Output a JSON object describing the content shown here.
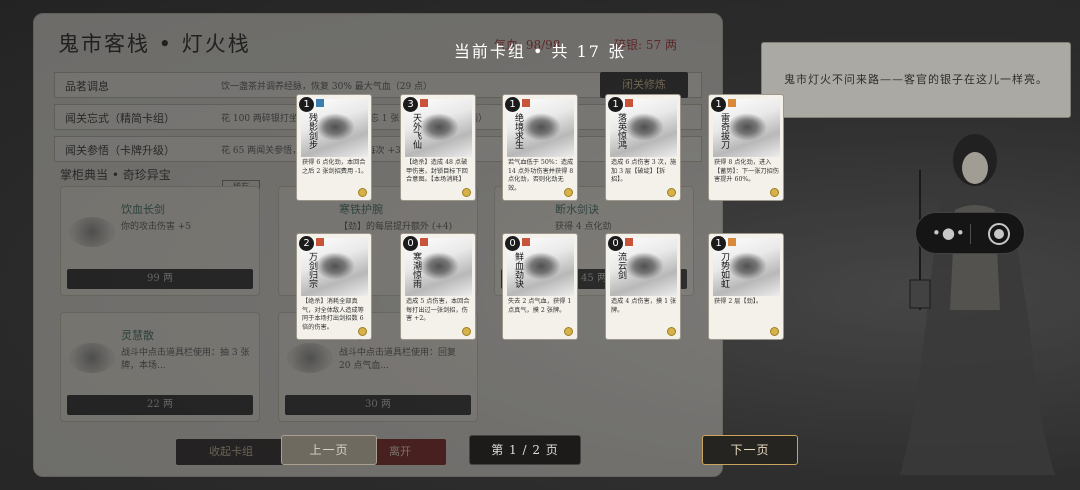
{
  "shop": {
    "title": "鬼市客栈 • 灯火栈",
    "stat_hp": "气血: 98/98",
    "stat_silver": "碎银: 57 两",
    "rows": [
      {
        "name": "品茗调息",
        "desc": "饮一盏茶并调养经脉，恢复 30% 最大气血（29 点）"
      },
      {
        "name": "闻关忘式（精简卡组）",
        "desc": "花 100 两碎银打坐，从卡组中永久遗忘 1 张卡牌（每次 +50 两）"
      },
      {
        "name": "闻关参悟（卡牌升级）",
        "desc": "花 65 两闻关参悟，升级 1 张卡牌（每次 +35 两）"
      }
    ],
    "rest_button": "闭关修炼",
    "section": "掌柜典当 • 奇珍异宝",
    "section_badge": "稀有",
    "items": [
      {
        "name": "饮血长剑",
        "desc": "你的攻击伤害 +5",
        "price": "99 两"
      },
      {
        "name": "寒铁护腕",
        "desc": "【劲】的每层提升额外 (+4)",
        "price": "88 两"
      },
      {
        "name": "断水剑诀",
        "desc": "获得 4 点化劲",
        "price": "45 两"
      },
      {
        "name": "灵慧散",
        "desc": "战斗中点击道具栏使用：抽 3 张牌，本场...",
        "price": "22 两"
      },
      {
        "name": "回气丹",
        "desc": "战斗中点击道具栏使用：回复 20 点气血...",
        "price": "30 两"
      }
    ],
    "collapse_button": "收起卡组",
    "leave_button": "离开"
  },
  "notice": "鬼市灯火不问来路——客官的银子在这儿一样亮。",
  "deck": {
    "title": "当前卡组 • 共 17 张",
    "cards": [
      {
        "cost": "1",
        "name": "残影剑步",
        "desc": "获得 6 点化劲，本回合之后 2 张剑招费用 -1。",
        "color": "#3b7fb0"
      },
      {
        "cost": "3",
        "name": "天外飞仙",
        "desc": "【绝杀】造成 48 点破甲伤害，封锁目标下回合意图。【本场消耗】",
        "color": "#c8553a"
      },
      {
        "cost": "1",
        "name": "绝境求生",
        "desc": "若气血低于 50%：造成 14 点外功伤害并获得 8 点化劲，否则化劲无效。",
        "color": "#c8553a"
      },
      {
        "cost": "1",
        "name": "落英惊鸿",
        "desc": "造成 6 点伤害 3 次，施加 3 层【破绽】【拆招】。",
        "color": "#c8553a"
      },
      {
        "cost": "1",
        "name": "雷奇拔刀",
        "desc": "获得 8 点化劲，进入【蓄势】：下一张刀招伤害提升 60%。",
        "color": "#d9893a"
      },
      {
        "cost": "2",
        "name": "万剑归宗",
        "desc": "【绝杀】消耗全部真气，对全体敌人造成等同于本场打出剑招数 6 倍的伤害。",
        "color": "#c8553a"
      },
      {
        "cost": "0",
        "name": "寒潮惊雨",
        "desc": "造成 5 点伤害，本回合每打出过一张剑招，伤害 +2。",
        "color": "#c8553a"
      },
      {
        "cost": "0",
        "name": "鲜血劲诀",
        "desc": "失去 2 点气血，获得 1 点真气，摸 2 张牌。",
        "color": "#c8553a"
      },
      {
        "cost": "0",
        "name": "流云剑",
        "desc": "造成 4 点伤害，摸 1 张牌。",
        "color": "#c8553a"
      },
      {
        "cost": "1",
        "name": "刀势如虹",
        "desc": "获得 2 层【劲】。",
        "color": "#d9893a"
      }
    ],
    "prev_button": "上一页",
    "next_button": "下一页",
    "page_label": "第 1 / 2 页"
  },
  "capsule": {
    "menu_icon": "•●•",
    "record_icon": "record"
  }
}
